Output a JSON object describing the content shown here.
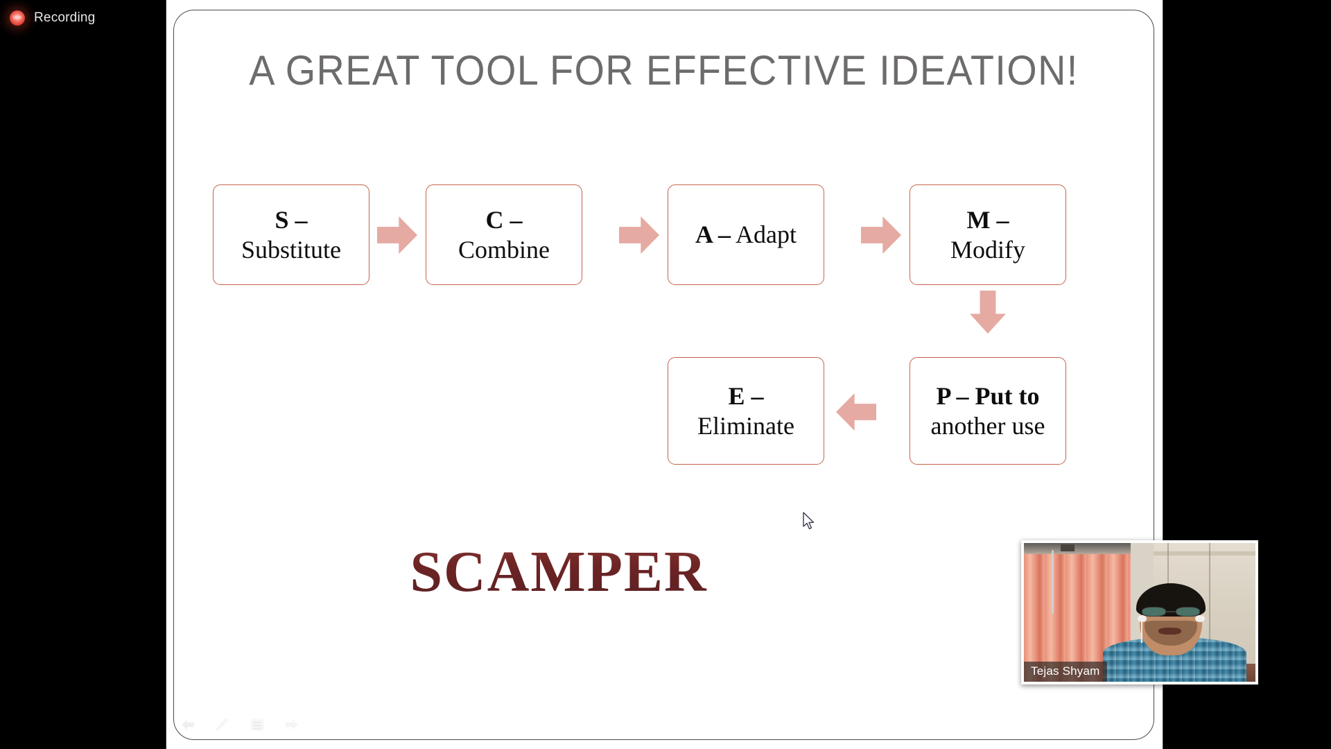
{
  "app": {
    "recording_indicator": {
      "icon": "record-dot-icon",
      "label": "Recording"
    }
  },
  "slide": {
    "title": "A GREAT TOOL FOR EFFECTIVE IDEATION!",
    "title_color": "#6e6b6b",
    "box_border_color": "#c4634a",
    "arrow_color": "#e5aaa2",
    "wordmark": "SCAMPER",
    "wordmark_color": "#6e2b2b",
    "boxes": [
      {
        "id": "s",
        "letter": "S –",
        "word": "Substitute",
        "single_line": false
      },
      {
        "id": "c",
        "letter": "C –",
        "word": "Combine",
        "single_line": false
      },
      {
        "id": "a",
        "letter": "A –",
        "word": "Adapt",
        "single_line": true
      },
      {
        "id": "m",
        "letter": "M –",
        "word": "Modify",
        "single_line": false
      },
      {
        "id": "e",
        "letter": "E –",
        "word": "Eliminate",
        "single_line": false
      },
      {
        "id": "p",
        "letter": "P – Put to",
        "word": "another use",
        "single_line": false
      }
    ],
    "arrows": [
      {
        "id": "s-to-c",
        "direction": "right"
      },
      {
        "id": "c-to-a",
        "direction": "right"
      },
      {
        "id": "a-to-m",
        "direction": "right"
      },
      {
        "id": "m-to-p",
        "direction": "down"
      },
      {
        "id": "p-to-e",
        "direction": "left"
      }
    ],
    "nav_controls": [
      {
        "name": "previous-slide",
        "icon": "arrow-left-icon"
      },
      {
        "name": "pen-annotate",
        "icon": "pen-icon"
      },
      {
        "name": "slide-menu",
        "icon": "menu-icon"
      },
      {
        "name": "next-slide",
        "icon": "arrow-right-icon"
      }
    ]
  },
  "video": {
    "participant_name": "Tejas Shyam"
  }
}
